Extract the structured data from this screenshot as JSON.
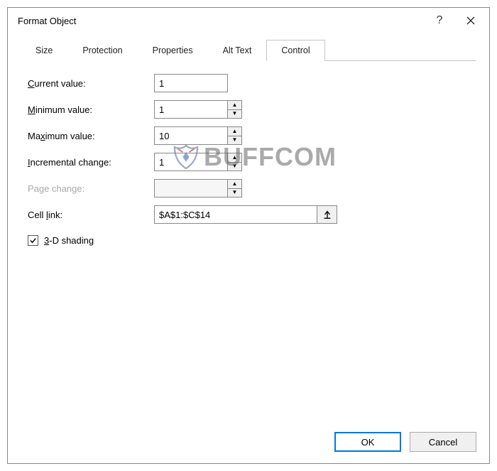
{
  "dialog": {
    "title": "Format Object"
  },
  "tabs": {
    "items": [
      {
        "label": "Size"
      },
      {
        "label": "Protection"
      },
      {
        "label": "Properties"
      },
      {
        "label": "Alt Text"
      },
      {
        "label": "Control"
      }
    ],
    "active_index": 4
  },
  "control": {
    "current_value": {
      "label": "Current value:",
      "value": "1"
    },
    "minimum_value": {
      "label": "Minimum value:",
      "value": "1"
    },
    "maximum_value": {
      "label": "Maximum value:",
      "value": "10"
    },
    "incremental_change": {
      "label": "Incremental change:",
      "value": "1"
    },
    "page_change": {
      "label": "Page change:",
      "value": ""
    },
    "cell_link": {
      "label": "Cell link:",
      "value": "$A$1:$C$14"
    },
    "shading": {
      "label": "3-D shading",
      "checked": true
    }
  },
  "footer": {
    "ok": "OK",
    "cancel": "Cancel"
  },
  "watermark": "BUFFCOM"
}
